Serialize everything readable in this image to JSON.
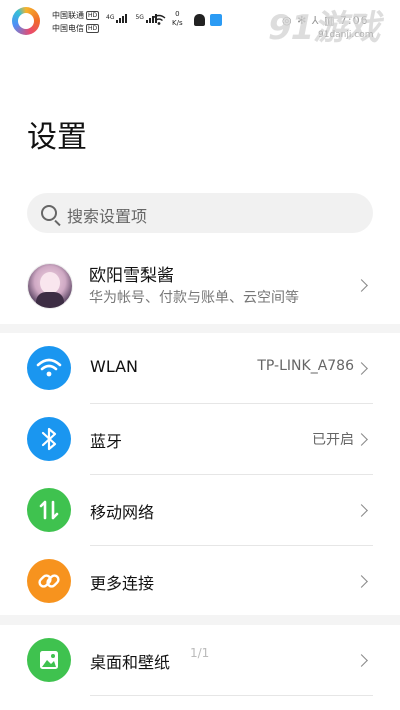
{
  "status_bar": {
    "carrier_1": "中国联通",
    "carrier_2": "中国电信",
    "hd_badge": "HD",
    "net_type_1": "4G",
    "net_type_2": "5G",
    "speed_value": "0",
    "speed_unit": "K/s",
    "right_text": "◎ ✻ ⅄ ▥ 7:06"
  },
  "watermark": {
    "logo": "91游戏",
    "url": "91danji.com"
  },
  "page": {
    "title": "设置"
  },
  "search": {
    "placeholder": "搜索设置项"
  },
  "account": {
    "name": "欧阳雪梨酱",
    "subtitle": "华为帐号、付款与账单、云空间等"
  },
  "settings": [
    {
      "label": "WLAN",
      "value": "TP-LINK_A786",
      "icon": "wifi-icon",
      "color": "#1a96f0"
    },
    {
      "label": "蓝牙",
      "value": "已开启",
      "icon": "bluetooth-icon",
      "color": "#1a96f0"
    },
    {
      "label": "移动网络",
      "value": "",
      "icon": "mobile-data-icon",
      "color": "#3fc24f"
    },
    {
      "label": "更多连接",
      "value": "",
      "icon": "link-icon",
      "color": "#f7931e"
    },
    {
      "label": "桌面和壁纸",
      "value": "",
      "icon": "wallpaper-icon",
      "color": "#3fc24f"
    }
  ],
  "page_indicator": "1/1"
}
